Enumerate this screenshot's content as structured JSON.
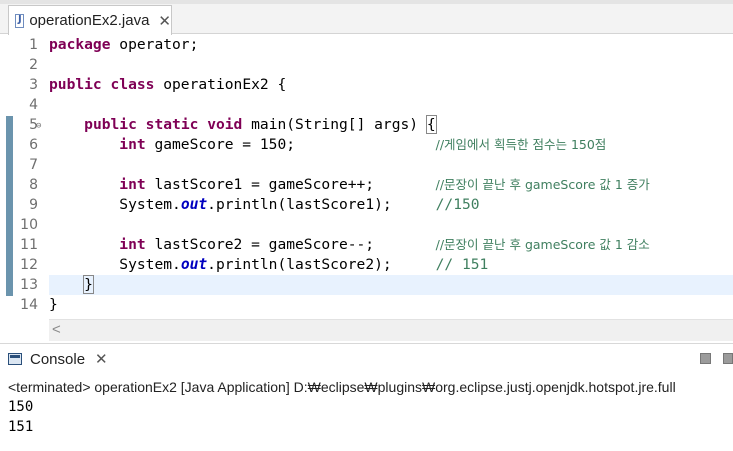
{
  "editor_tab": {
    "title": "operationEx2.java",
    "close": "✕"
  },
  "code_lines": [
    {
      "num": "1",
      "fold": ""
    },
    {
      "num": "2",
      "fold": ""
    },
    {
      "num": "3",
      "fold": ""
    },
    {
      "num": "4",
      "fold": ""
    },
    {
      "num": "5",
      "fold": "⊖"
    },
    {
      "num": "6",
      "fold": ""
    },
    {
      "num": "7",
      "fold": ""
    },
    {
      "num": "8",
      "fold": ""
    },
    {
      "num": "9",
      "fold": ""
    },
    {
      "num": "10",
      "fold": ""
    },
    {
      "num": "11",
      "fold": ""
    },
    {
      "num": "12",
      "fold": ""
    },
    {
      "num": "13",
      "fold": ""
    },
    {
      "num": "14",
      "fold": ""
    }
  ],
  "code": {
    "l1": {
      "kw": "package",
      "rest": " operator;"
    },
    "l3": {
      "kw1": "public",
      "kw2": "class",
      "rest": " operationEx2 {"
    },
    "l5": {
      "indent": "    ",
      "kw1": "public",
      "kw2": "static",
      "kw3": "void",
      "rest": " main(String[] args) ",
      "brace": "{"
    },
    "l6": {
      "indent": "        ",
      "kw": "int",
      "rest": " gameScore = 150;                ",
      "comment": "//게임에서 획득한 점수는 150점"
    },
    "l8": {
      "indent": "        ",
      "kw": "int",
      "rest": " lastScore1 = gameScore++;       ",
      "comment": "//문장이 끝난 후 gameScore 값 1 증가"
    },
    "l9": {
      "indent": "        ",
      "pre": "System.",
      "field": "out",
      "rest": ".println(lastScore1);     ",
      "comment": "//150"
    },
    "l11": {
      "indent": "        ",
      "kw": "int",
      "rest": " lastScore2 = gameScore--;       ",
      "comment": "//문장이 끝난 후 gameScore 값 1 감소"
    },
    "l12": {
      "indent": "        ",
      "pre": "System.",
      "field": "out",
      "rest": ".println(lastScore2);     ",
      "comment": "// 151"
    },
    "l13": {
      "indent": "    ",
      "brace": "}"
    },
    "l14": {
      "brace": "}"
    }
  },
  "scroll_left_icon": "<",
  "console": {
    "title": "Console",
    "close": "✕",
    "status": "<terminated> operationEx2 [Java Application] D:₩eclipse₩plugins₩org.eclipse.justj.openjdk.hotspot.jre.full",
    "output": [
      "150",
      "151"
    ]
  }
}
